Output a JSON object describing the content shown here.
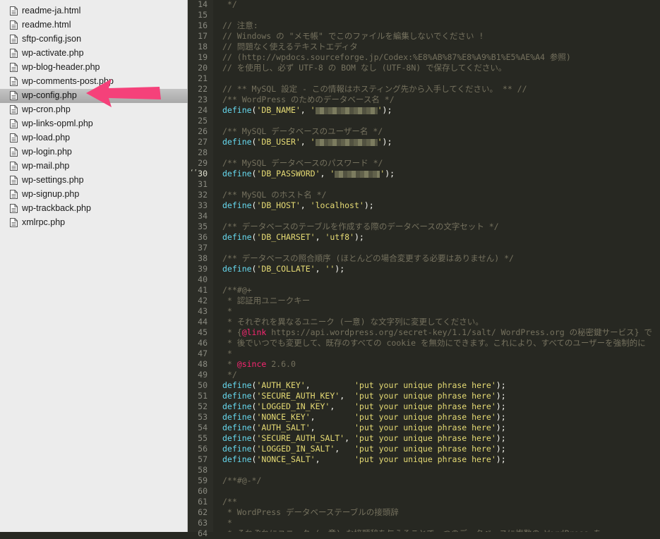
{
  "sidebar": {
    "files": [
      {
        "name": "readme-ja.html",
        "selected": false
      },
      {
        "name": "readme.html",
        "selected": false
      },
      {
        "name": "sftp-config.json",
        "selected": false
      },
      {
        "name": "wp-activate.php",
        "selected": false
      },
      {
        "name": "wp-blog-header.php",
        "selected": false
      },
      {
        "name": "wp-comments-post.php",
        "selected": false
      },
      {
        "name": "wp-config.php",
        "selected": true
      },
      {
        "name": "wp-cron.php",
        "selected": false
      },
      {
        "name": "wp-links-opml.php",
        "selected": false
      },
      {
        "name": "wp-load.php",
        "selected": false
      },
      {
        "name": "wp-login.php",
        "selected": false
      },
      {
        "name": "wp-mail.php",
        "selected": false
      },
      {
        "name": "wp-settings.php",
        "selected": false
      },
      {
        "name": "wp-signup.php",
        "selected": false
      },
      {
        "name": "wp-trackback.php",
        "selected": false
      },
      {
        "name": "xmlrpc.php",
        "selected": false
      }
    ]
  },
  "editor": {
    "current_line": 30,
    "lines": [
      {
        "n": "14",
        "segs": [
          {
            "t": " */",
            "c": "cm"
          }
        ]
      },
      {
        "n": "15",
        "segs": []
      },
      {
        "n": "16",
        "segs": [
          {
            "t": "// 注意:",
            "c": "cm"
          }
        ]
      },
      {
        "n": "17",
        "segs": [
          {
            "t": "// Windows の \"メモ帳\" でこのファイルを編集しないでください !",
            "c": "cm"
          }
        ]
      },
      {
        "n": "18",
        "segs": [
          {
            "t": "// 問題なく使えるテキストエディタ",
            "c": "cm"
          }
        ]
      },
      {
        "n": "19",
        "segs": [
          {
            "t": "// (http://wpdocs.sourceforge.jp/Codex:%E8%AB%87%E8%A9%B1%E5%AE%A4 参照)",
            "c": "cm"
          }
        ]
      },
      {
        "n": "20",
        "segs": [
          {
            "t": "// を使用し、必ず UTF-8 の BOM なし (UTF-8N) で保存してください。",
            "c": "cm"
          }
        ]
      },
      {
        "n": "21",
        "segs": []
      },
      {
        "n": "22",
        "segs": [
          {
            "t": "// ** MySQL 設定 - この情報はホスティング先から入手してください。 ** //",
            "c": "cm"
          }
        ]
      },
      {
        "n": "23",
        "segs": [
          {
            "t": "/** WordPress のためのデータベース名 */",
            "c": "cm"
          }
        ]
      },
      {
        "n": "24",
        "segs": [
          {
            "t": "define",
            "c": "fn"
          },
          {
            "t": "(",
            "c": ""
          },
          {
            "t": "'DB_NAME'",
            "c": "str"
          },
          {
            "t": ", ",
            "c": ""
          },
          {
            "t": "'",
            "c": "str"
          },
          {
            "blur": 88
          },
          {
            "t": "'",
            "c": "str"
          },
          {
            "t": ");",
            "c": ""
          }
        ]
      },
      {
        "n": "25",
        "segs": []
      },
      {
        "n": "26",
        "segs": [
          {
            "t": "/** MySQL データベースのユーザー名 */",
            "c": "cm"
          }
        ]
      },
      {
        "n": "27",
        "segs": [
          {
            "t": "define",
            "c": "fn"
          },
          {
            "t": "(",
            "c": ""
          },
          {
            "t": "'DB_USER'",
            "c": "str"
          },
          {
            "t": ", ",
            "c": ""
          },
          {
            "t": "'",
            "c": "str"
          },
          {
            "blur": 88
          },
          {
            "t": "'",
            "c": "str"
          },
          {
            "t": ");",
            "c": ""
          }
        ]
      },
      {
        "n": "28",
        "segs": []
      },
      {
        "n": "29",
        "segs": [
          {
            "t": "/** MySQL データベースのパスワード */",
            "c": "cm"
          }
        ]
      },
      {
        "n": "30",
        "segs": [
          {
            "t": "define",
            "c": "fn"
          },
          {
            "t": "(",
            "c": ""
          },
          {
            "t": "'DB_PASSWORD'",
            "c": "str"
          },
          {
            "t": ", ",
            "c": ""
          },
          {
            "t": "'",
            "c": "str"
          },
          {
            "blur": 64
          },
          {
            "t": "'",
            "c": "str"
          },
          {
            "t": ");",
            "c": ""
          }
        ]
      },
      {
        "n": "31",
        "segs": []
      },
      {
        "n": "32",
        "segs": [
          {
            "t": "/** MySQL のホスト名 */",
            "c": "cm"
          }
        ]
      },
      {
        "n": "33",
        "segs": [
          {
            "t": "define",
            "c": "fn"
          },
          {
            "t": "(",
            "c": ""
          },
          {
            "t": "'DB_HOST'",
            "c": "str"
          },
          {
            "t": ", ",
            "c": ""
          },
          {
            "t": "'localhost'",
            "c": "str"
          },
          {
            "t": ");",
            "c": ""
          }
        ]
      },
      {
        "n": "34",
        "segs": []
      },
      {
        "n": "35",
        "segs": [
          {
            "t": "/** データベースのテーブルを作成する際のデータベースの文字セット */",
            "c": "cm"
          }
        ]
      },
      {
        "n": "36",
        "segs": [
          {
            "t": "define",
            "c": "fn"
          },
          {
            "t": "(",
            "c": ""
          },
          {
            "t": "'DB_CHARSET'",
            "c": "str"
          },
          {
            "t": ", ",
            "c": ""
          },
          {
            "t": "'utf8'",
            "c": "str"
          },
          {
            "t": ");",
            "c": ""
          }
        ]
      },
      {
        "n": "37",
        "segs": []
      },
      {
        "n": "38",
        "segs": [
          {
            "t": "/** データベースの照合順序 (ほとんどの場合変更する必要はありません) */",
            "c": "cm"
          }
        ]
      },
      {
        "n": "39",
        "segs": [
          {
            "t": "define",
            "c": "fn"
          },
          {
            "t": "(",
            "c": ""
          },
          {
            "t": "'DB_COLLATE'",
            "c": "str"
          },
          {
            "t": ", ",
            "c": ""
          },
          {
            "t": "''",
            "c": "str"
          },
          {
            "t": ");",
            "c": ""
          }
        ]
      },
      {
        "n": "40",
        "segs": []
      },
      {
        "n": "41",
        "segs": [
          {
            "t": "/**#@+",
            "c": "cm"
          }
        ]
      },
      {
        "n": "42",
        "segs": [
          {
            "t": " * 認証用ユニークキー",
            "c": "cm"
          }
        ]
      },
      {
        "n": "43",
        "segs": [
          {
            "t": " *",
            "c": "cm"
          }
        ]
      },
      {
        "n": "44",
        "segs": [
          {
            "t": " * それぞれを異なるユニーク (一意) な文字列に変更してください。",
            "c": "cm"
          }
        ]
      },
      {
        "n": "45",
        "segs": [
          {
            "t": " * {",
            "c": "cm"
          },
          {
            "t": "@link",
            "c": "tag"
          },
          {
            "t": " https://api.wordpress.org/secret-key/1.1/salt/ WordPress.org の秘密鍵サービス} で",
            "c": "cm"
          }
        ]
      },
      {
        "n": "46",
        "segs": [
          {
            "t": " * 後でいつでも変更して、既存のすべての cookie を無効にできます。これにより、すべてのユーザーを強制的に",
            "c": "cm"
          }
        ]
      },
      {
        "n": "47",
        "segs": [
          {
            "t": " *",
            "c": "cm"
          }
        ]
      },
      {
        "n": "48",
        "segs": [
          {
            "t": " * ",
            "c": "cm"
          },
          {
            "t": "@since",
            "c": "tag"
          },
          {
            "t": " 2.6.0",
            "c": "cm"
          }
        ]
      },
      {
        "n": "49",
        "segs": [
          {
            "t": " */",
            "c": "cm"
          }
        ]
      },
      {
        "n": "50",
        "segs": [
          {
            "t": "define",
            "c": "fn"
          },
          {
            "t": "(",
            "c": ""
          },
          {
            "t": "'AUTH_KEY'",
            "c": "str"
          },
          {
            "t": ",         ",
            "c": ""
          },
          {
            "t": "'put your unique phrase here'",
            "c": "str"
          },
          {
            "t": ");",
            "c": ""
          }
        ]
      },
      {
        "n": "51",
        "segs": [
          {
            "t": "define",
            "c": "fn"
          },
          {
            "t": "(",
            "c": ""
          },
          {
            "t": "'SECURE_AUTH_KEY'",
            "c": "str"
          },
          {
            "t": ",  ",
            "c": ""
          },
          {
            "t": "'put your unique phrase here'",
            "c": "str"
          },
          {
            "t": ");",
            "c": ""
          }
        ]
      },
      {
        "n": "52",
        "segs": [
          {
            "t": "define",
            "c": "fn"
          },
          {
            "t": "(",
            "c": ""
          },
          {
            "t": "'LOGGED_IN_KEY'",
            "c": "str"
          },
          {
            "t": ",    ",
            "c": ""
          },
          {
            "t": "'put your unique phrase here'",
            "c": "str"
          },
          {
            "t": ");",
            "c": ""
          }
        ]
      },
      {
        "n": "53",
        "segs": [
          {
            "t": "define",
            "c": "fn"
          },
          {
            "t": "(",
            "c": ""
          },
          {
            "t": "'NONCE_KEY'",
            "c": "str"
          },
          {
            "t": ",        ",
            "c": ""
          },
          {
            "t": "'put your unique phrase here'",
            "c": "str"
          },
          {
            "t": ");",
            "c": ""
          }
        ]
      },
      {
        "n": "54",
        "segs": [
          {
            "t": "define",
            "c": "fn"
          },
          {
            "t": "(",
            "c": ""
          },
          {
            "t": "'AUTH_SALT'",
            "c": "str"
          },
          {
            "t": ",        ",
            "c": ""
          },
          {
            "t": "'put your unique phrase here'",
            "c": "str"
          },
          {
            "t": ");",
            "c": ""
          }
        ]
      },
      {
        "n": "55",
        "segs": [
          {
            "t": "define",
            "c": "fn"
          },
          {
            "t": "(",
            "c": ""
          },
          {
            "t": "'SECURE_AUTH_SALT'",
            "c": "str"
          },
          {
            "t": ", ",
            "c": ""
          },
          {
            "t": "'put your unique phrase here'",
            "c": "str"
          },
          {
            "t": ");",
            "c": ""
          }
        ]
      },
      {
        "n": "56",
        "segs": [
          {
            "t": "define",
            "c": "fn"
          },
          {
            "t": "(",
            "c": ""
          },
          {
            "t": "'LOGGED_IN_SALT'",
            "c": "str"
          },
          {
            "t": ",   ",
            "c": ""
          },
          {
            "t": "'put your unique phrase here'",
            "c": "str"
          },
          {
            "t": ");",
            "c": ""
          }
        ]
      },
      {
        "n": "57",
        "segs": [
          {
            "t": "define",
            "c": "fn"
          },
          {
            "t": "(",
            "c": ""
          },
          {
            "t": "'NONCE_SALT'",
            "c": "str"
          },
          {
            "t": ",       ",
            "c": ""
          },
          {
            "t": "'put your unique phrase here'",
            "c": "str"
          },
          {
            "t": ");",
            "c": ""
          }
        ]
      },
      {
        "n": "58",
        "segs": []
      },
      {
        "n": "59",
        "segs": [
          {
            "t": "/**#@-*/",
            "c": "cm"
          }
        ]
      },
      {
        "n": "60",
        "segs": []
      },
      {
        "n": "61",
        "segs": [
          {
            "t": "/**",
            "c": "cm"
          }
        ]
      },
      {
        "n": "62",
        "segs": [
          {
            "t": " * WordPress データベーステーブルの接頭辞",
            "c": "cm"
          }
        ]
      },
      {
        "n": "63",
        "segs": [
          {
            "t": " *",
            "c": "cm"
          }
        ]
      },
      {
        "n": "64",
        "segs": [
          {
            "t": " * それぞれにユニーク (一意) な接頭辞を与えることで一つのデータベースに複数の WordPress を",
            "c": "cm"
          }
        ]
      }
    ]
  },
  "colors": {
    "editor_bg": "#272822",
    "comment": "#75715e",
    "function": "#66d9ef",
    "string": "#e6db74",
    "doc_tag": "#f92672",
    "annotation_arrow": "#f5417a"
  },
  "icons": {
    "file": "file-document-icon",
    "arrow": "pink-annotation-arrow"
  }
}
